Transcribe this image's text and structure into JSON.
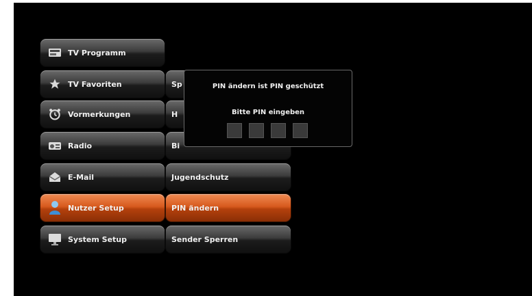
{
  "main_menu": {
    "items": [
      {
        "label": "TV Programm",
        "icon": "tv-guide-icon"
      },
      {
        "label": "TV Favoriten",
        "icon": "star-icon"
      },
      {
        "label": "Vormerkungen",
        "icon": "alarm-clock-icon"
      },
      {
        "label": "Radio",
        "icon": "radio-icon"
      },
      {
        "label": "E-Mail",
        "icon": "mail-icon"
      },
      {
        "label": "Nutzer Setup",
        "icon": "user-icon",
        "active": true
      },
      {
        "label": "System Setup",
        "icon": "monitor-icon"
      }
    ]
  },
  "submenu": {
    "items": [
      {
        "label": "Sp"
      },
      {
        "label": "H"
      },
      {
        "label": "Bi"
      },
      {
        "label": "Jugendschutz"
      },
      {
        "label": "PIN ändern",
        "active": true
      },
      {
        "label": "Sender Sperren"
      }
    ]
  },
  "pin_dialog": {
    "title": "PIN ändern ist PIN geschützt",
    "prompt": "Bitte PIN eingeben",
    "digits": 4
  },
  "colors": {
    "background": "#000000",
    "highlight": "#d75a1e",
    "button": "#3c3c3c",
    "text": "#f0f0f0"
  }
}
